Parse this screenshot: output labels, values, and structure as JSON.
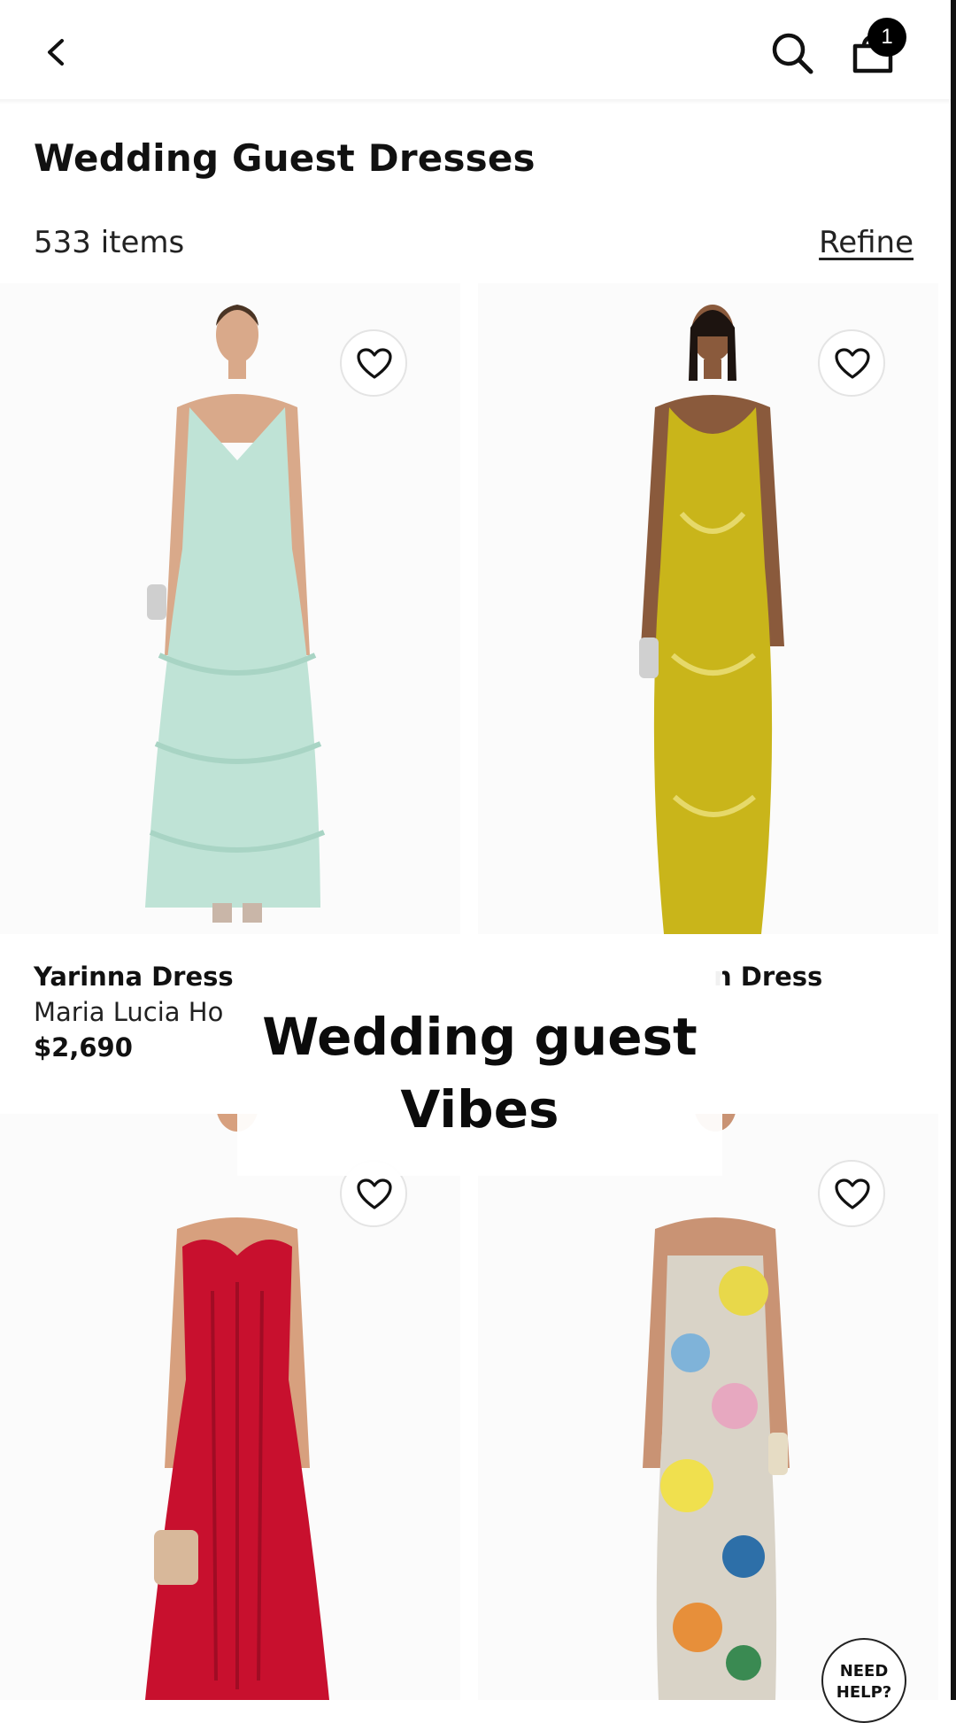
{
  "header": {
    "back_icon": "chevron-left-icon",
    "search_icon": "search-icon",
    "bag_icon": "shopping-bag-icon",
    "bag_count": "1"
  },
  "listing": {
    "title": "Wedding Guest Dresses",
    "item_count": "533 items",
    "refine_label": "Refine"
  },
  "products": [
    {
      "name": "Yarinna Dress",
      "brand": "Maria Lucia Ho",
      "price": "$2,690",
      "dress_color": "#bfe3d6",
      "favorite": false
    },
    {
      "name": "n Dress",
      "brand": "",
      "price": "",
      "dress_color": "#c9b51a",
      "favorite": false
    },
    {
      "name": "",
      "brand": "",
      "price": "",
      "dress_color": "#c8102e",
      "favorite": false
    },
    {
      "name": "",
      "brand": "",
      "price": "",
      "dress_color": "#d9d3c7",
      "favorite": false
    }
  ],
  "overlay": {
    "line1": "Wedding guest",
    "line2": "Vibes"
  },
  "help": {
    "line1": "NEED",
    "line2": "HELP?"
  },
  "colors": {
    "text": "#111111",
    "badge": "#000000",
    "background": "#ffffff"
  }
}
